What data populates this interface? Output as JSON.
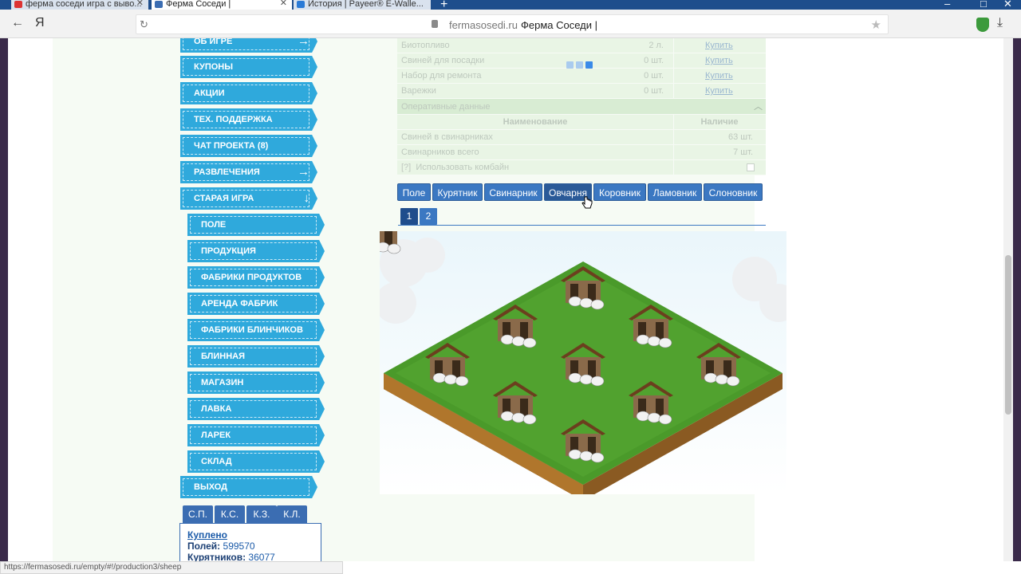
{
  "browser": {
    "tabs": [
      {
        "label": "ферма соседи игра с выво...",
        "favicon_color": "#d33"
      },
      {
        "label": "Ферма Соседи |",
        "favicon_color": "#3b6db2"
      },
      {
        "label": "История | Payeer® E-Walle...",
        "favicon_color": "#2a7ad6"
      }
    ],
    "new_tab": "+",
    "address": {
      "domain": "fermasosedi.ru",
      "page_title": "Ферма Соседи |"
    },
    "controls": {
      "back": "←",
      "yandex": "Я",
      "reload": "↻",
      "star": "★",
      "download": "⤓"
    },
    "window": {
      "minimize": "–",
      "maximize": "□",
      "close": "✕"
    }
  },
  "sidebar": {
    "items": [
      {
        "label": "ОБ ИГРЕ",
        "arrow": "→"
      },
      {
        "label": "КУПОНЫ"
      },
      {
        "label": "АКЦИИ"
      },
      {
        "label": "ТЕХ. ПОДДЕРЖКА"
      },
      {
        "label": "ЧАТ ПРОЕКТА (8)"
      },
      {
        "label": "РАЗВЛЕЧЕНИЯ",
        "arrow": "→"
      },
      {
        "label": "СТАРАЯ ИГРА",
        "arrow": "↓"
      }
    ],
    "subitems": [
      {
        "label": "ПОЛЕ"
      },
      {
        "label": "ПРОДУКЦИЯ"
      },
      {
        "label": "ФАБРИКИ ПРОДУКТОВ"
      },
      {
        "label": "АРЕНДА ФАБРИК"
      },
      {
        "label": "ФАБРИКИ БЛИНЧИКОВ"
      },
      {
        "label": "БЛИННАЯ"
      },
      {
        "label": "МАГАЗИН"
      },
      {
        "label": "ЛАВКА"
      },
      {
        "label": "ЛАРЕК"
      },
      {
        "label": "СКЛАД"
      }
    ],
    "logout": "ВЫХОД",
    "stat_tabs": [
      "С.П.",
      "К.С.",
      "К.З.",
      "К.Л."
    ],
    "info": {
      "title": "Куплено",
      "fields_label": "Полей:",
      "fields_value": "599570",
      "coops_label": "Курятников:",
      "coops_value": "36077"
    }
  },
  "table": {
    "rows": [
      {
        "name": "Биотопливо",
        "amount": "2 л.",
        "action": "Купить"
      },
      {
        "name": "Свиней для посадки",
        "amount": "0 шт.",
        "action": "Купить"
      },
      {
        "name": "Набор для ремонта",
        "amount": "0 шт.",
        "action": "Купить"
      },
      {
        "name": "Варежки",
        "amount": "0 шт.",
        "action": "Купить"
      }
    ],
    "section_title": "Оперативные данные",
    "header": {
      "name": "Наименование",
      "availability": "Наличие"
    },
    "op_rows": [
      {
        "name": "Свиней в свинарниках",
        "value": "63 шт."
      },
      {
        "name": "Свинарников всего",
        "value": "7 шт."
      }
    ],
    "combine_help": "[?]",
    "combine_label": "Использовать комбайн"
  },
  "building_tabs": [
    "Поле",
    "Курятник",
    "Свинарник",
    "Овчарня",
    "Коровник",
    "Ламовник",
    "Слоновник"
  ],
  "active_building_tab": "Овчарня",
  "pager": [
    "1",
    "2"
  ],
  "status_url": "https://fermasosedi.ru/empty/#!/production3/sheep",
  "colors": {
    "menu_blue": "#2fa9dc",
    "tab_blue": "#3b78c2",
    "grass": "#4a9a2a"
  }
}
